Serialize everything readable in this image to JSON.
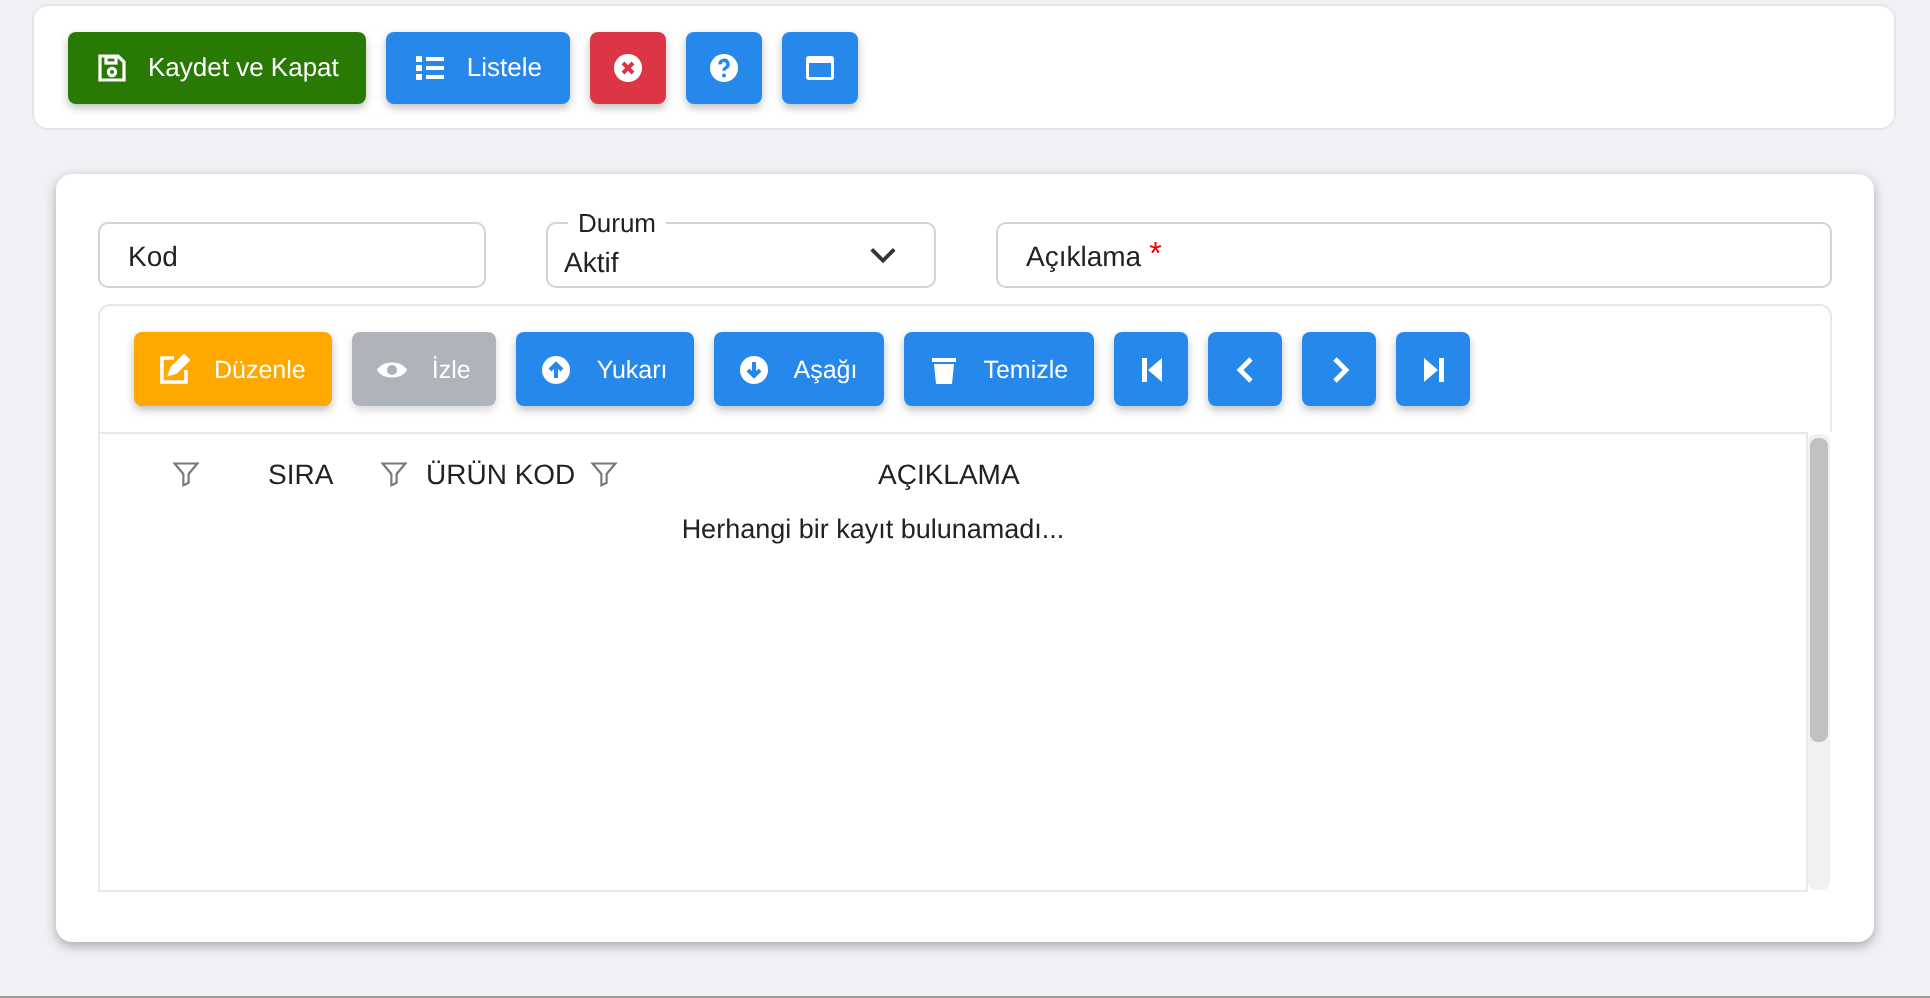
{
  "top_toolbar": [
    {
      "label": "Kaydet ve Kapat",
      "kind": "save"
    },
    {
      "label": "Listele",
      "kind": "list"
    },
    {
      "kind": "close"
    },
    {
      "kind": "help"
    },
    {
      "kind": "window"
    }
  ],
  "form": {
    "kod": {
      "placeholder": "Kod"
    },
    "durum": {
      "label": "Durum",
      "value": "Aktif"
    },
    "aciklama": {
      "placeholder": "Açıklama",
      "required_mark": "*"
    }
  },
  "grid_toolbar": [
    {
      "label": "Düzenle",
      "kind": "edit",
      "disabled": false
    },
    {
      "label": "İzle",
      "kind": "eye",
      "disabled": true
    },
    {
      "label": "Yukarı",
      "kind": "up",
      "disabled": false
    },
    {
      "label": "Aşağı",
      "kind": "down",
      "disabled": false
    },
    {
      "label": "Temizle",
      "kind": "trash",
      "disabled": false
    },
    {
      "kind": "first",
      "disabled": false
    },
    {
      "kind": "prev",
      "disabled": false
    },
    {
      "kind": "next",
      "disabled": false
    },
    {
      "kind": "last",
      "disabled": false
    }
  ],
  "table": {
    "columns": [
      "SIRA",
      "ÜRÜN KOD",
      "AÇIKLAMA"
    ],
    "empty_message": "Herhangi bir kayıt bulunamadı..."
  }
}
